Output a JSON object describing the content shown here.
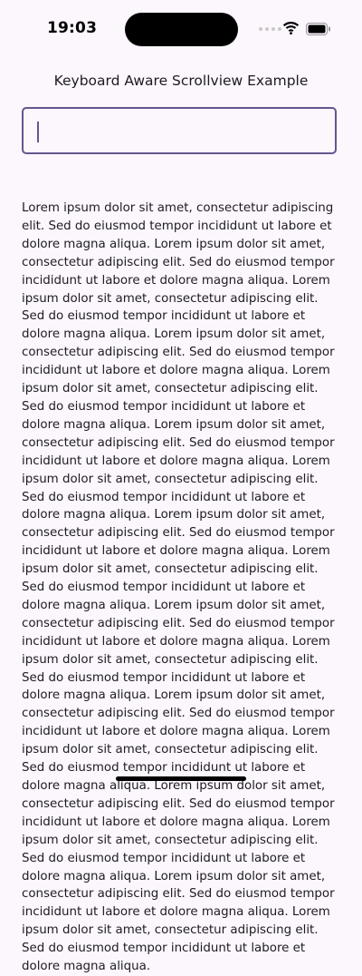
{
  "status_bar": {
    "time": "19:03"
  },
  "icons": {
    "wifi": "wifi-icon",
    "battery": "battery-icon",
    "signal": "cellular-signal-icon"
  },
  "colors": {
    "background": "#fcf6fd",
    "accent": "#65558f",
    "text": "#1d1b20"
  },
  "header": {
    "title": "Keyboard Aware Scrollview Example"
  },
  "input": {
    "value": "",
    "placeholder": ""
  },
  "content": {
    "paragraph": "Lorem ipsum dolor sit amet, consectetur adipiscing elit. Sed do eiusmod tempor incididunt ut labore et dolore magna aliqua. Lorem ipsum dolor sit amet, consectetur adipiscing elit. Sed do eiusmod tempor incididunt ut labore et dolore magna aliqua. Lorem ipsum dolor sit amet, consectetur adipiscing elit. Sed do eiusmod tempor incididunt ut labore et dolore magna aliqua. Lorem ipsum dolor sit amet, consectetur adipiscing elit. Sed do eiusmod tempor incididunt ut labore et dolore magna aliqua. Lorem ipsum dolor sit amet, consectetur adipiscing elit. Sed do eiusmod tempor incididunt ut labore et dolore magna aliqua. Lorem ipsum dolor sit amet, consectetur adipiscing elit. Sed do eiusmod tempor incididunt ut labore et dolore magna aliqua. Lorem ipsum dolor sit amet, consectetur adipiscing elit. Sed do eiusmod tempor incididunt ut labore et dolore magna aliqua. Lorem ipsum dolor sit amet, consectetur adipiscing elit. Sed do eiusmod tempor incididunt ut labore et dolore magna aliqua. Lorem ipsum dolor sit amet, consectetur adipiscing elit. Sed do eiusmod tempor incididunt ut labore et dolore magna aliqua. Lorem ipsum dolor sit amet, consectetur adipiscing elit. Sed do eiusmod tempor incididunt ut labore et dolore magna aliqua. Lorem ipsum dolor sit amet, consectetur adipiscing elit. Sed do eiusmod tempor incididunt ut labore et dolore magna aliqua. Lorem ipsum dolor sit amet, consectetur adipiscing elit. Sed do eiusmod tempor incididunt ut labore et dolore magna aliqua. Lorem ipsum dolor sit amet, consectetur adipiscing elit. Sed do eiusmod tempor incididunt ut labore et dolore magna aliqua. Lorem ipsum dolor sit amet, consectetur adipiscing elit. Sed do eiusmod tempor incididunt ut labore et dolore magna aliqua. Lorem ipsum dolor sit amet, consectetur adipiscing elit. Sed do eiusmod tempor incididunt ut labore et dolore magna aliqua. Lorem ipsum dolor sit amet, consectetur adipiscing elit. Sed do eiusmod tempor incididunt ut labore et dolore magna aliqua. Lorem ipsum dolor sit amet, consectetur adipiscing elit. Sed do eiusmod tempor incididunt ut labore et dolore magna aliqua."
  }
}
